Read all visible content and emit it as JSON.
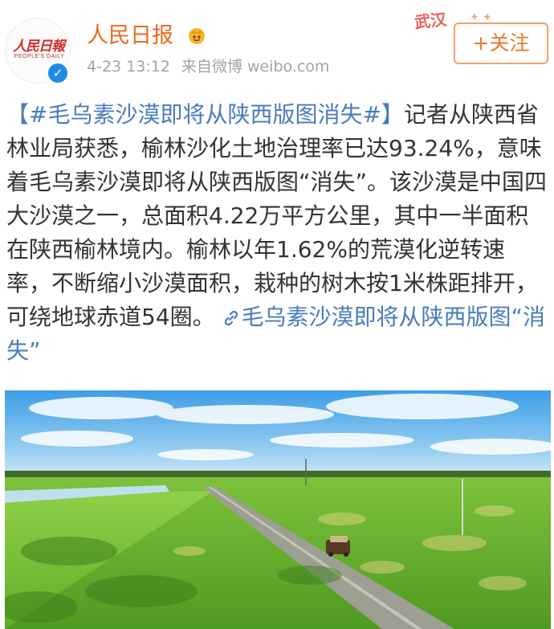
{
  "account": {
    "name": "人民日报",
    "avatar_text": "人民日報",
    "avatar_subtext": "PEOPLE'S DAILY",
    "verified": true
  },
  "meta": {
    "time": "4-23 13:12",
    "source": "来自微博 weibo.com"
  },
  "badge_text": "武汉",
  "follow_button": "+关注",
  "post": {
    "topic": "【#毛乌素沙漠即将从陕西版图消失#】",
    "body": "记者从陕西省林业局获悉，榆林沙化土地治理率已达93.24%，意味着毛乌素沙漠即将从陕西版图“消失”。该沙漠是中国四大沙漠之一，总面积4.22万平方公里，其中一半面积在陕西榆林境内。榆林以年1.62%的荒漠化逆转速率，不断缩小沙漠面积，栽种的树木按1米株距排开，可绕地球赤道54圈。",
    "link_text": "毛乌素沙漠即将从陕西版图“消失”"
  },
  "colors": {
    "name": "#ea6a1f",
    "topic_link": "#4a7bbf",
    "follow": "#ea7a2a",
    "verified": "#1e8ce6"
  },
  "icons": [
    "crown-emoji-icon",
    "verified-icon",
    "link-icon"
  ]
}
